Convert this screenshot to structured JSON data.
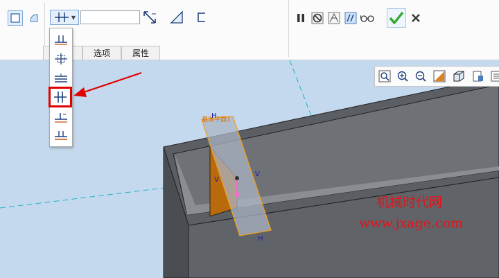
{
  "toolbar": {
    "value_input": "",
    "tabs": [
      {
        "label": ""
      },
      {
        "label": "选项"
      },
      {
        "label": "属性"
      }
    ]
  },
  "dropdown": {
    "items": [
      {
        "name": "align-bottom-icon"
      },
      {
        "name": "center-point-icon"
      },
      {
        "name": "parallel-lines-icon"
      },
      {
        "name": "symmetric-icon",
        "highlighted": true
      },
      {
        "name": "offset-icon"
      },
      {
        "name": "double-offset-icon"
      }
    ]
  },
  "viewport": {
    "labels": {
      "datum_name": "基准平面1",
      "h_top": "H",
      "h_bottom": "H",
      "v_left": "V",
      "v_right": "V"
    }
  },
  "watermark": {
    "line1": "机械时代网",
    "line2": "www.jxage.com"
  },
  "colors": {
    "accent": "#e00000",
    "ok_green": "#2eaa2e",
    "datum_orange": "#f0a020",
    "viewport_bg": "#c5d9ee"
  }
}
